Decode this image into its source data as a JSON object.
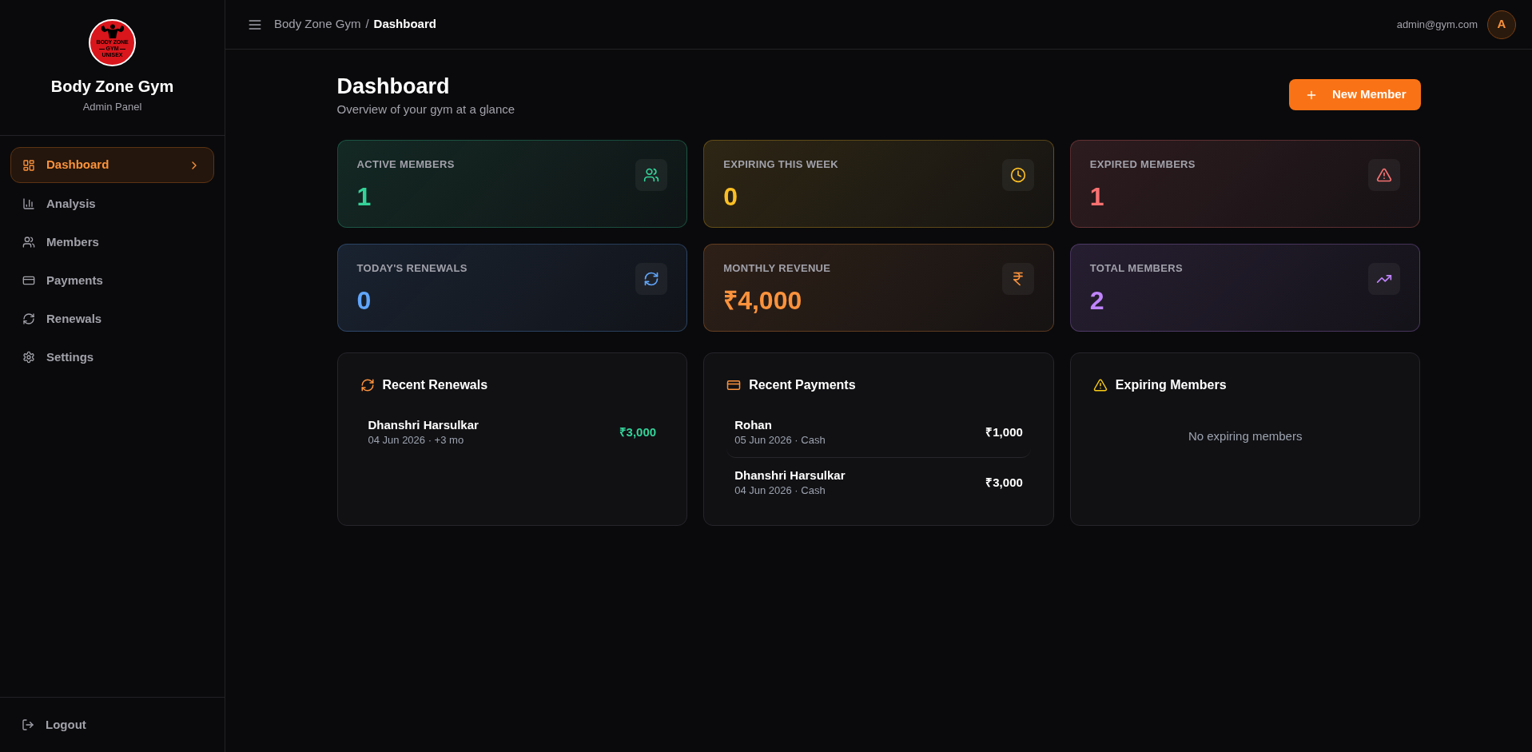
{
  "sidebar": {
    "logo": {
      "lines": [
        "BODY ZONE",
        "GYM",
        "UNISEX"
      ]
    },
    "title": "Body Zone Gym",
    "subtitle": "Admin Panel",
    "items": [
      {
        "label": "Dashboard",
        "selected": true
      },
      {
        "label": "Analysis",
        "selected": false
      },
      {
        "label": "Members",
        "selected": false
      },
      {
        "label": "Payments",
        "selected": false
      },
      {
        "label": "Renewals",
        "selected": false
      },
      {
        "label": "Settings",
        "selected": false
      }
    ],
    "footer_item": {
      "label": "Logout"
    }
  },
  "topbar": {
    "breadcrumb": [
      "Body Zone Gym",
      "Dashboard"
    ],
    "separator": "/",
    "user_email": "admin@gym.com",
    "avatar_initial": "A"
  },
  "header": {
    "title": "Dashboard",
    "subtitle": "Overview of your gym at a glance",
    "action": "New Member"
  },
  "stats": [
    {
      "label": "ACTIVE MEMBERS",
      "value": "1",
      "color": "#34d399"
    },
    {
      "label": "EXPIRING THIS WEEK",
      "value": "0",
      "color": "#fbbf24"
    },
    {
      "label": "EXPIRED MEMBERS",
      "value": "1",
      "color": "#f87171"
    },
    {
      "label": "TODAY'S RENEWALS",
      "value": "0",
      "color": "#60a5fa"
    },
    {
      "label": "MONTHLY REVENUE",
      "value": "₹4,000",
      "color": "#fb923c"
    },
    {
      "label": "TOTAL MEMBERS",
      "value": "2",
      "color": "#c084fc"
    }
  ],
  "panels": [
    {
      "kind": "renewals",
      "title": "Recent Renewals",
      "rows": [
        {
          "name": "Dhanshri Harsulkar",
          "detail": "04 Jun 2026 · +3 mo",
          "amount": "₹3,000"
        }
      ]
    },
    {
      "kind": "payments",
      "title": "Recent Payments",
      "rows": [
        {
          "name": "Rohan",
          "detail": "05 Jun 2026 · Cash",
          "amount": "₹1,000"
        },
        {
          "name": "Dhanshri Harsulkar",
          "detail": "04 Jun 2026 · Cash",
          "amount": "₹3,000"
        }
      ]
    },
    {
      "kind": "expiring",
      "title": "Expiring Members",
      "empty_text": "No expiring members"
    }
  ]
}
